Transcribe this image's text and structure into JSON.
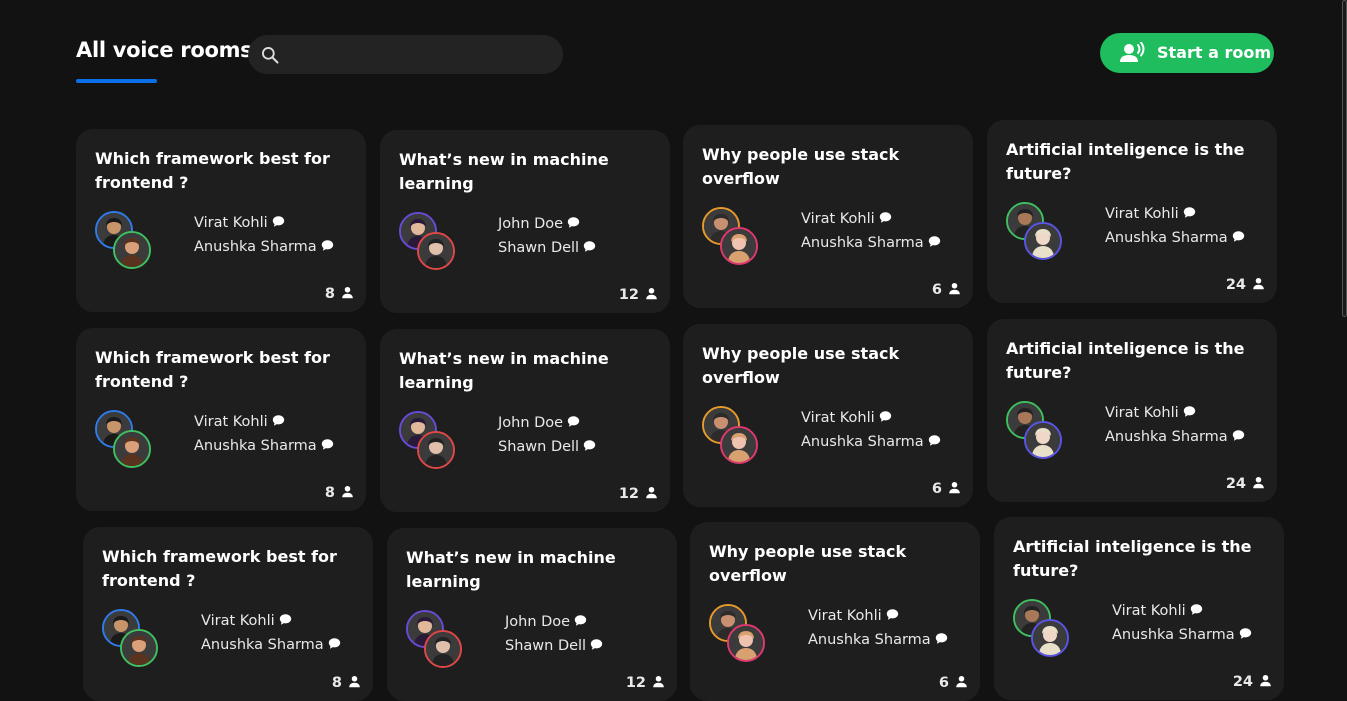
{
  "header": {
    "title": "All voice rooms",
    "search_placeholder": "",
    "start_button_label": "Start a room"
  },
  "colors": {
    "accent_blue": "#0b6fe8",
    "start_green": "#20bd5f",
    "card_bg": "#1e1e1e",
    "page_bg": "#121212"
  },
  "rooms": [
    {
      "title": "Which framework best for frontend ?",
      "speakers": [
        "Virat Kohli",
        "Anushka Sharma"
      ],
      "listeners": "8",
      "ring1": "#2f7bea",
      "ring2": "#3fbf5f"
    },
    {
      "title": "What’s new in machine learning",
      "speakers": [
        "John Doe",
        "Shawn  Dell"
      ],
      "listeners": "12",
      "ring1": "#6a4bd8",
      "ring2": "#e04848"
    },
    {
      "title": "Why people use stack overflow",
      "speakers": [
        "Virat Kohli",
        "Anushka Sharma"
      ],
      "listeners": "6",
      "ring1": "#e79a2c",
      "ring2": "#e0386f"
    },
    {
      "title": "Artificial inteligence is the future?",
      "speakers": [
        "Virat Kohli",
        "Anushka Sharma"
      ],
      "listeners": "24",
      "ring1": "#3fbf5f",
      "ring2": "#5a55e6"
    },
    {
      "title": "Which framework best for frontend ?",
      "speakers": [
        "Virat Kohli",
        "Anushka Sharma"
      ],
      "listeners": "8",
      "ring1": "#2f7bea",
      "ring2": "#3fbf5f"
    },
    {
      "title": "What’s new in machine learning",
      "speakers": [
        "John Doe",
        "Shawn  Dell"
      ],
      "listeners": "12",
      "ring1": "#6a4bd8",
      "ring2": "#e04848"
    },
    {
      "title": "Why people use stack overflow",
      "speakers": [
        "Virat Kohli",
        "Anushka Sharma"
      ],
      "listeners": "6",
      "ring1": "#e79a2c",
      "ring2": "#e0386f"
    },
    {
      "title": "Artificial inteligence is the future?",
      "speakers": [
        "Virat Kohli",
        "Anushka Sharma"
      ],
      "listeners": "24",
      "ring1": "#3fbf5f",
      "ring2": "#5a55e6"
    },
    {
      "title": "Which framework best for frontend ?",
      "speakers": [
        "Virat Kohli",
        "Anushka Sharma"
      ],
      "listeners": "8",
      "ring1": "#2f7bea",
      "ring2": "#3fbf5f"
    },
    {
      "title": "What’s new in machine learning",
      "speakers": [
        "John Doe",
        "Shawn  Dell"
      ],
      "listeners": "12",
      "ring1": "#6a4bd8",
      "ring2": "#e04848"
    },
    {
      "title": "Why people use stack overflow",
      "speakers": [
        "Virat Kohli",
        "Anushka Sharma"
      ],
      "listeners": "6",
      "ring1": "#e79a2c",
      "ring2": "#e0386f"
    },
    {
      "title": "Artificial inteligence is the future?",
      "speakers": [
        "Virat Kohli",
        "Anushka Sharma"
      ],
      "listeners": "24",
      "ring1": "#3fbf5f",
      "ring2": "#5a55e6"
    }
  ]
}
